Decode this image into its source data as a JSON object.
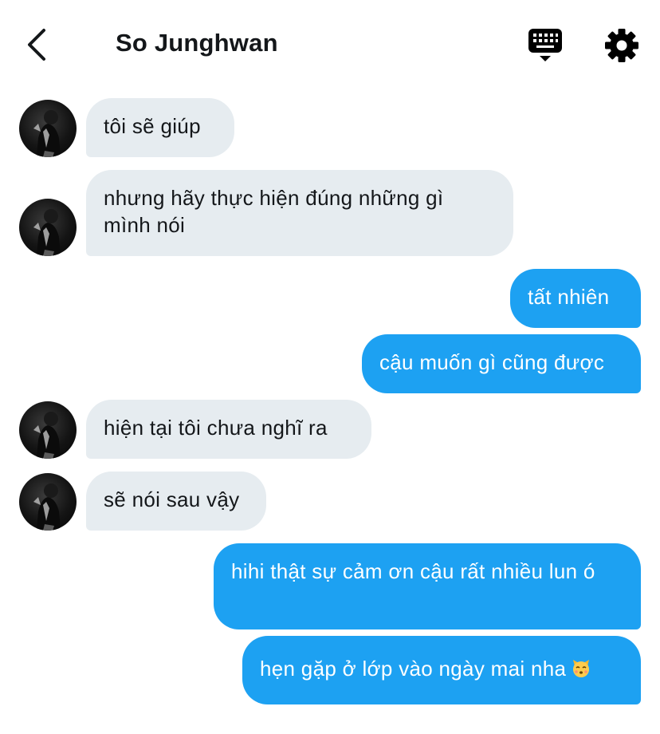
{
  "header": {
    "title": "So Junghwan",
    "back_icon": "chevron-left-icon",
    "keyboard_icon": "keyboard-icon",
    "settings_icon": "gear-icon"
  },
  "colors": {
    "incoming_bubble": "#e6ecf0",
    "outgoing_bubble": "#1da1f2",
    "outgoing_text": "#ffffff",
    "text": "#14171a"
  },
  "messages": [
    {
      "direction": "incoming",
      "text": "tôi sẽ giúp"
    },
    {
      "direction": "incoming",
      "text": "nhưng hãy thực hiện đúng những gì mình nói"
    },
    {
      "direction": "outgoing",
      "text": "tất nhiên"
    },
    {
      "direction": "outgoing",
      "text": "cậu muốn gì cũng được"
    },
    {
      "direction": "incoming",
      "text": "hiện tại tôi chưa nghĩ ra"
    },
    {
      "direction": "incoming",
      "text": "sẽ nói sau vậy"
    },
    {
      "direction": "outgoing",
      "text": "hihi thật sự cảm ơn cậu rất nhiều lun ó"
    },
    {
      "direction": "outgoing",
      "text": "hẹn gặp ở lớp vào ngày mai nha",
      "emoji": "kissing-cat-emoji"
    }
  ]
}
